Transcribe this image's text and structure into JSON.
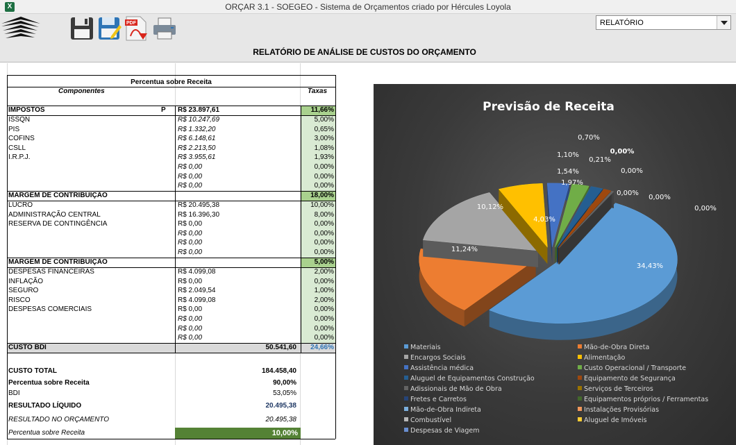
{
  "window": {
    "title": "ORÇAR 3.1 - SOEGEO - Sistema de Orçamentos criado por Hércules Loyola",
    "app_icon": "excel-icon"
  },
  "toolbar": {
    "icons": [
      "logo-icon",
      "save-icon",
      "edit-icon",
      "pdf-export-icon",
      "print-icon"
    ],
    "dropdown_value": "RELATÓRIO",
    "report_title": "RELATÓRIO DE ANÁLISE DE CUSTOS DO ORÇAMENTO"
  },
  "table": {
    "header": "Percentua sobre Receita",
    "col_components": "Componentes",
    "col_taxas": "Taxas",
    "impostos": {
      "label": "IMPOSTOS",
      "flag": "P",
      "value": "R$ 23.897,61",
      "rate": "11,66%",
      "items": [
        {
          "label": "ISSQN",
          "value": "R$ 10.247,69",
          "rate": "5,00%"
        },
        {
          "label": "PIS",
          "value": "R$ 1.332,20",
          "rate": "0,65%"
        },
        {
          "label": "COFINS",
          "value": "R$ 6.148,61",
          "rate": "3,00%"
        },
        {
          "label": "CSLL",
          "value": "R$ 2.213,50",
          "rate": "1,08%"
        },
        {
          "label": "I.R.P.J.",
          "value": "R$ 3.955,61",
          "rate": "1,93%"
        },
        {
          "label": "",
          "value": "R$ 0,00",
          "rate": "0,00%"
        },
        {
          "label": "",
          "value": "R$ 0,00",
          "rate": "0,00%"
        },
        {
          "label": "",
          "value": "R$ 0,00",
          "rate": "0,00%"
        }
      ]
    },
    "margem1": {
      "label": "MARGEM DE CONTRIBUIÇÃO",
      "rate": "18,00%",
      "items": [
        {
          "label": "LUCRO",
          "value": "R$ 20.495,38",
          "rate": "10,00%"
        },
        {
          "label": "ADMINISTRAÇÃO CENTRAL",
          "value": "R$ 16.396,30",
          "rate": "8,00%"
        },
        {
          "label": "RESERVA DE CONTINGÊNCIA",
          "value": "R$ 0,00",
          "rate": "0,00%"
        },
        {
          "label": "",
          "value": "R$ 0,00",
          "rate": "0,00%"
        },
        {
          "label": "",
          "value": "R$ 0,00",
          "rate": "0,00%"
        },
        {
          "label": "",
          "value": "R$ 0,00",
          "rate": "0,00%"
        }
      ]
    },
    "margem2": {
      "label": "MARGEM DE CONTRIBUIÇÃO",
      "rate": "5,00%",
      "items": [
        {
          "label": "DESPESAS FINANCEIRAS",
          "value": "R$ 4.099,08",
          "rate": "2,00%"
        },
        {
          "label": "INFLAÇÃO",
          "value": "R$ 0,00",
          "rate": "0,00%"
        },
        {
          "label": "SEGURO",
          "value": "R$ 2.049,54",
          "rate": "1,00%"
        },
        {
          "label": "RISCO",
          "value": "R$ 4.099,08",
          "rate": "2,00%"
        },
        {
          "label": "DESPESAS COMERCIAIS",
          "value": "R$ 0,00",
          "rate": "0,00%"
        },
        {
          "label": "",
          "value": "R$ 0,00",
          "rate": "0,00%"
        },
        {
          "label": "",
          "value": "R$ 0,00",
          "rate": "0,00%"
        },
        {
          "label": "",
          "value": "R$ 0,00",
          "rate": "0,00%"
        }
      ]
    },
    "custo_bdi": {
      "label": "CUSTO BDI",
      "value": "50.541,60",
      "rate": "24,66%"
    },
    "summary": {
      "custo_total_label": "CUSTO TOTAL",
      "custo_total_value": "184.458,40",
      "percentua_label": "Percentua sobre Receita",
      "percentua_value": "90,00%",
      "bdi_label": "BDI",
      "bdi_value": "53,05%",
      "resultado_liquido_label": "RESULTADO LÍQUIDO",
      "resultado_liquido_value": "20.495,38",
      "resultado_orcamento_label": "RESULTADO NO ORÇAMENTO",
      "resultado_orcamento_value": "20.495,38",
      "percentua2_label": "Percentua sobre Receita",
      "percentua2_value": "10,00%"
    }
  },
  "chart_data": {
    "type": "pie",
    "title": "Previsão de Receita",
    "categories": [
      "Materiais",
      "Mão-de-Obra Direta",
      "Encargos Sociais",
      "Alimentação",
      "Assistência médica",
      "Custo Operacional / Transporte",
      "Aluguel de Equipamentos Construção",
      "Equipamento de Segurança",
      "Adissionais de Mão de Obra",
      "Serviços de Terceiros",
      "Fretes e Carretos",
      "Equipamentos próprios / Ferramentas",
      "Mão-de-Obra Indireta",
      "Instalações Provisórias",
      "Combustível",
      "Aluguel de Imóveis",
      "Despesas de Viagem"
    ],
    "slices": [
      {
        "label": "34,43%",
        "value": 34.43,
        "color": "#5b9bd5"
      },
      {
        "label": "11,24%",
        "value": 11.24,
        "color": "#ed7d31"
      },
      {
        "label": "10,12%",
        "value": 10.12,
        "color": "#a5a5a5"
      },
      {
        "label": "4,03%",
        "value": 4.03,
        "color": "#ffc000"
      },
      {
        "label": "1,97%",
        "value": 1.97,
        "color": "#4472c4"
      },
      {
        "label": "1,54%",
        "value": 1.54,
        "color": "#70ad47"
      },
      {
        "label": "1,10%",
        "value": 1.1,
        "color": "#255e91"
      },
      {
        "label": "0,70%",
        "value": 0.7,
        "color": "#9e480e"
      },
      {
        "label": "0,21%",
        "value": 0.21,
        "color": "#636363"
      },
      {
        "label": "0,00%",
        "value": 0.0,
        "color": "#997300"
      },
      {
        "label": "0,00%",
        "value": 0.0,
        "color": "#264478"
      },
      {
        "label": "0,00%",
        "value": 0.0,
        "color": "#43682b"
      },
      {
        "label": "0,00%",
        "value": 0.0,
        "color": "#7cafdd"
      },
      {
        "label": "0,00%",
        "value": 0.0,
        "color": "#f1975a"
      },
      {
        "label": "0,00%",
        "value": 0.0,
        "color": "#b7b7b7"
      },
      {
        "label": "0,00%",
        "value": 0.0,
        "color": "#ffcd33"
      },
      {
        "label": "0,00%",
        "value": 0.0,
        "color": "#698ed0"
      }
    ],
    "legend_colors": [
      "#5b9bd5",
      "#ed7d31",
      "#a5a5a5",
      "#ffc000",
      "#4472c4",
      "#70ad47",
      "#255e91",
      "#9e480e",
      "#636363",
      "#997300",
      "#264478",
      "#43682b",
      "#7cafdd",
      "#f1975a",
      "#b7b7b7",
      "#ffcd33",
      "#698ed0"
    ],
    "legend_position": "bottom"
  }
}
